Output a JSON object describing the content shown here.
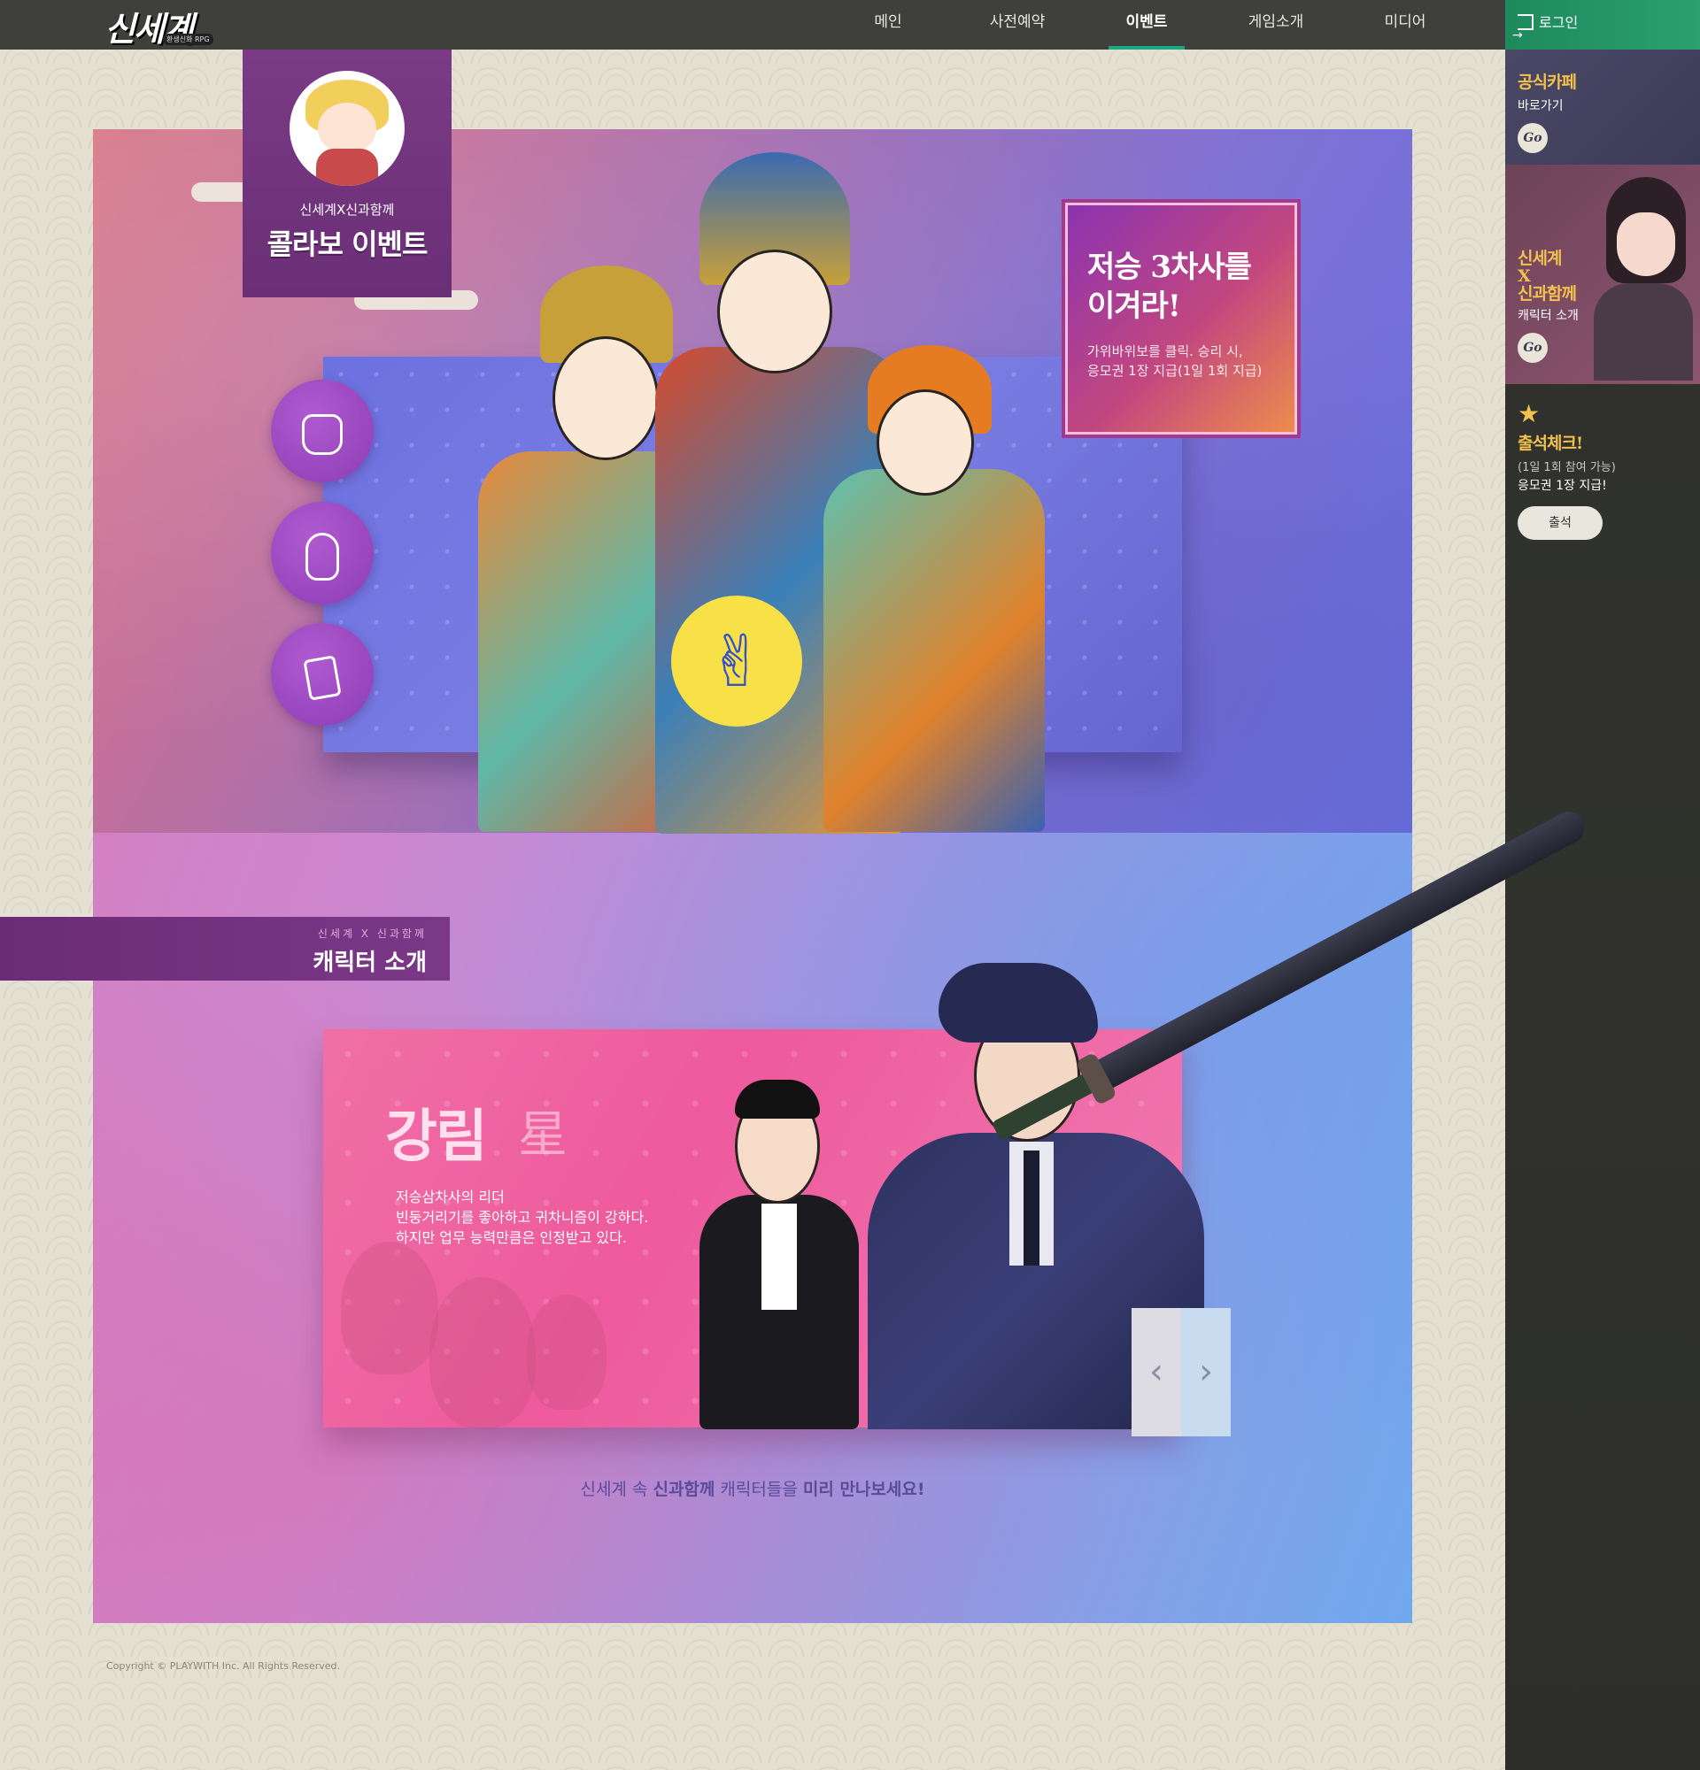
{
  "header": {
    "logo_main": "신세계",
    "logo_sub": "환생신화 RPG",
    "nav": [
      "메인",
      "사전예약",
      "이벤트",
      "게임소개",
      "미디어"
    ],
    "active_nav": "이벤트"
  },
  "sidebar": {
    "login": "로그인",
    "cafe": {
      "title": "공식카페",
      "sub": "바로가기",
      "go": "Go"
    },
    "collab": {
      "title_line1": "신세계",
      "title_line2": "X",
      "title_line3": "신과함께",
      "sub": "캐릭터 소개",
      "go": "Go"
    },
    "attendance": {
      "title": "출석체크!",
      "note": "(1일 1회 참여 가능)",
      "reward": "응모권 1장 지급!",
      "button": "출석"
    }
  },
  "event": {
    "badge_sub": "신세계X신과함께",
    "badge_title": "콜라보 이벤트",
    "challenge_title": "저승 3차사를\n이겨라!",
    "challenge_desc": "가위바위보를 클릭. 승리 시,\n응모권 1장 지급(1일 1회 지급)"
  },
  "characters": {
    "label_sub": "신세계 X 신과함께",
    "label_title": "캐릭터 소개",
    "name": "강림",
    "hanja": "星",
    "description": "저승삼차사의 리더\n빈둥거리기를 좋아하고 귀차니즘이 강하다.\n하지만 업무 능력만큼은 인정받고 있다.",
    "promo_pre": "신세계 속 ",
    "promo_em1": "신과함께",
    "promo_mid": " 캐릭터들을 ",
    "promo_em2": "미리 만나보세요!"
  },
  "footer": {
    "copyright": "Copyright © PLAYWITH Inc. All Rights Reserved."
  },
  "icons": [
    "login-icon",
    "star-icon",
    "rock-icon",
    "paper-icon",
    "scissors-icon",
    "chevron-left-icon",
    "chevron-right-icon"
  ],
  "colors": {
    "accent": "#1aa882",
    "purple": "#6b2c77",
    "yellow": "#f8e146",
    "gold": "#f2c14e"
  }
}
